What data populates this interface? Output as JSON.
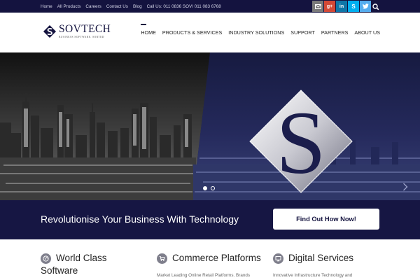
{
  "topbar": {
    "links": [
      "Home",
      "All Products",
      "Careers",
      "Contact Us",
      "Blog"
    ],
    "phone": "Call Us: 011 0836 SOV/ 011 083 6768",
    "social": [
      "mail-icon",
      "google-plus-icon",
      "linkedin-icon",
      "skype-icon",
      "twitter-icon"
    ],
    "social_glyphs": {
      "gplus": "g+",
      "linkedin": "in",
      "skype": "S"
    }
  },
  "logo": {
    "name": "SOVTECH",
    "tagline": "BUSINESS SOFTWARE. SORTED"
  },
  "nav": {
    "items": [
      "HOME",
      "PRODUCTS & SERVICES",
      "INDUSTRY SOLUTIONS",
      "SUPPORT",
      "PARTNERS",
      "ABOUT US"
    ],
    "active": "HOME"
  },
  "hero": {
    "logo_letter": "S",
    "slides": 2,
    "active_slide": 1
  },
  "cta": {
    "text": "Revolutionise Your Business With Technology",
    "button": "Find Out How Now!"
  },
  "services": [
    {
      "title_line1": "World Class",
      "title_line2": "Software",
      "icon": "globe-icon",
      "desc": ""
    },
    {
      "title_line1": "Commerce Platforms",
      "title_line2": "",
      "icon": "cart-icon",
      "desc": "Market Leading Online Retail Platforms. Brands"
    },
    {
      "title_line1": "Digital Services",
      "title_line2": "",
      "icon": "monitor-icon",
      "desc": "Innovative Infrastructure Technology and"
    }
  ],
  "colors": {
    "navy": "#14133f",
    "band": "#161643",
    "white": "#ffffff"
  }
}
